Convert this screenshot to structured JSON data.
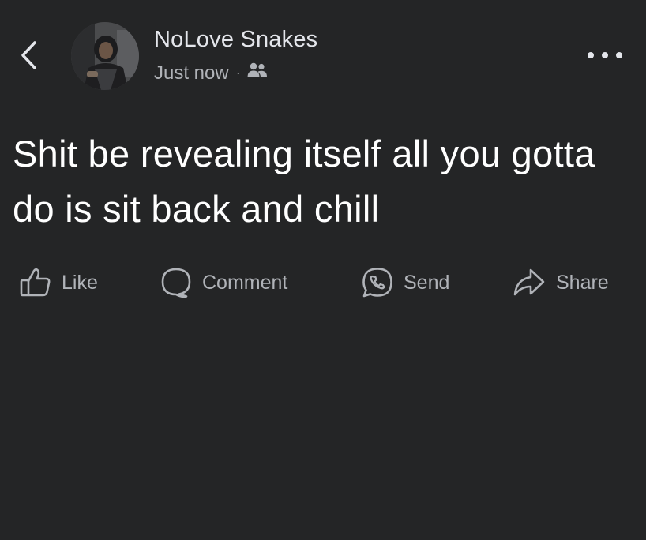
{
  "post": {
    "author": "NoLove Snakes",
    "time": "Just now",
    "separator": "·",
    "audience_icon": "friends-icon",
    "text": "Shit be revealing itself all you gotta do is sit back and chill"
  },
  "header": {
    "back_icon": "chevron-left-icon",
    "more_icon": "more-options-icon"
  },
  "actions": [
    {
      "label": "Like",
      "icon": "thumbs-up-icon"
    },
    {
      "label": "Comment",
      "icon": "comment-icon"
    },
    {
      "label": "Send",
      "icon": "messenger-icon"
    },
    {
      "label": "Share",
      "icon": "share-arrow-icon"
    }
  ],
  "colors": {
    "background": "#242526",
    "primary_text": "#e4e6eb",
    "secondary_text": "#b0b3b8"
  }
}
